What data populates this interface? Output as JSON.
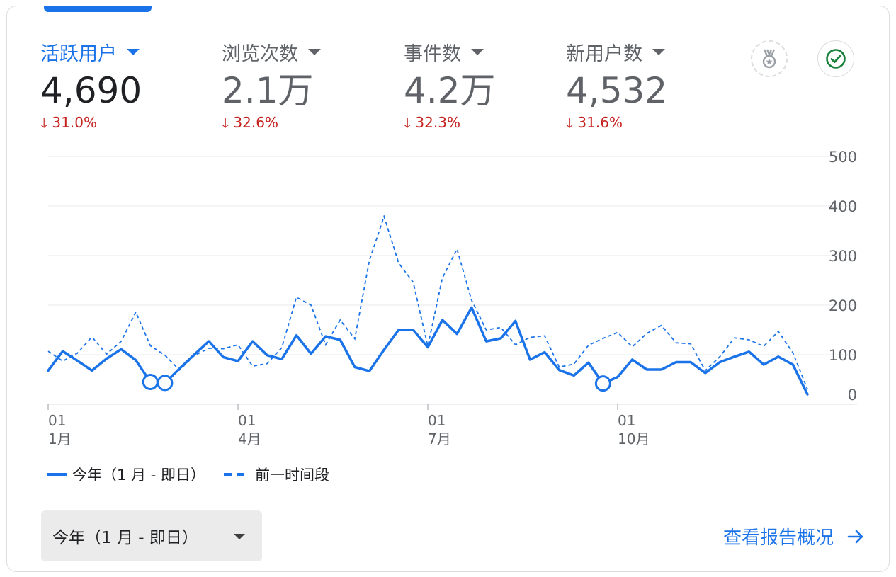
{
  "metrics": [
    {
      "label": "活跃用户",
      "value": "4,690",
      "delta": "31.0%",
      "active": true
    },
    {
      "label": "浏览次数",
      "value": "2.1万",
      "delta": "32.6%",
      "active": false
    },
    {
      "label": "事件数",
      "value": "4.2万",
      "delta": "32.3%",
      "active": false
    },
    {
      "label": "新用户数",
      "value": "4,532",
      "delta": "31.6%",
      "active": false
    }
  ],
  "icons": {
    "badge": "medal-badge-icon",
    "check": "check-circle-icon",
    "delta": "arrow-down-icon",
    "report": "arrow-right-icon"
  },
  "colors": {
    "accent": "#1a73e8",
    "negative": "#c5221f",
    "series": "#1a73e8",
    "grid": "#e8eaed"
  },
  "legend": {
    "current": "今年（1 月 - 即日）",
    "previous": "前一时间段"
  },
  "range_selector": {
    "label": "今年（1 月 - 即日）"
  },
  "report_link": {
    "label": "查看报告概况"
  },
  "chart_data": {
    "type": "line",
    "x_ticks": [
      {
        "day": "01",
        "month": "1月",
        "index": 0
      },
      {
        "day": "01",
        "month": "4月",
        "index": 13
      },
      {
        "day": "01",
        "month": "7月",
        "index": 26
      },
      {
        "day": "01",
        "month": "10月",
        "index": 39
      }
    ],
    "y_ticks": [
      0,
      100,
      200,
      300,
      400,
      500
    ],
    "ylim": [
      0,
      500
    ],
    "grid": true,
    "legend_position": "bottom-left",
    "series": [
      {
        "name": "今年（1 月 - 即日）",
        "style": "solid",
        "values": [
          68,
          107,
          88,
          68,
          92,
          111,
          89,
          45,
          43,
          72,
          100,
          127,
          95,
          87,
          127,
          99,
          91,
          139,
          102,
          137,
          130,
          75,
          67,
          110,
          150,
          150,
          115,
          170,
          142,
          195,
          127,
          133,
          168,
          90,
          105,
          69,
          58,
          84,
          42,
          55,
          90,
          70,
          70,
          85,
          85,
          63,
          85,
          96,
          106,
          80,
          96,
          80,
          20
        ],
        "markers": [
          {
            "index": 7,
            "value": 45
          },
          {
            "index": 8,
            "value": 43
          },
          {
            "index": 38,
            "value": 42
          }
        ]
      },
      {
        "name": "前一时间段",
        "style": "dashed",
        "values": [
          107,
          87,
          103,
          136,
          101,
          127,
          186,
          118,
          99,
          69,
          98,
          113,
          112,
          120,
          77,
          82,
          114,
          216,
          200,
          120,
          170,
          132,
          290,
          379,
          285,
          246,
          117,
          255,
          313,
          210,
          150,
          155,
          120,
          135,
          138,
          75,
          81,
          119,
          133,
          145,
          116,
          143,
          159,
          124,
          122,
          68,
          96,
          134,
          130,
          117,
          147,
          104,
          30
        ]
      }
    ]
  }
}
